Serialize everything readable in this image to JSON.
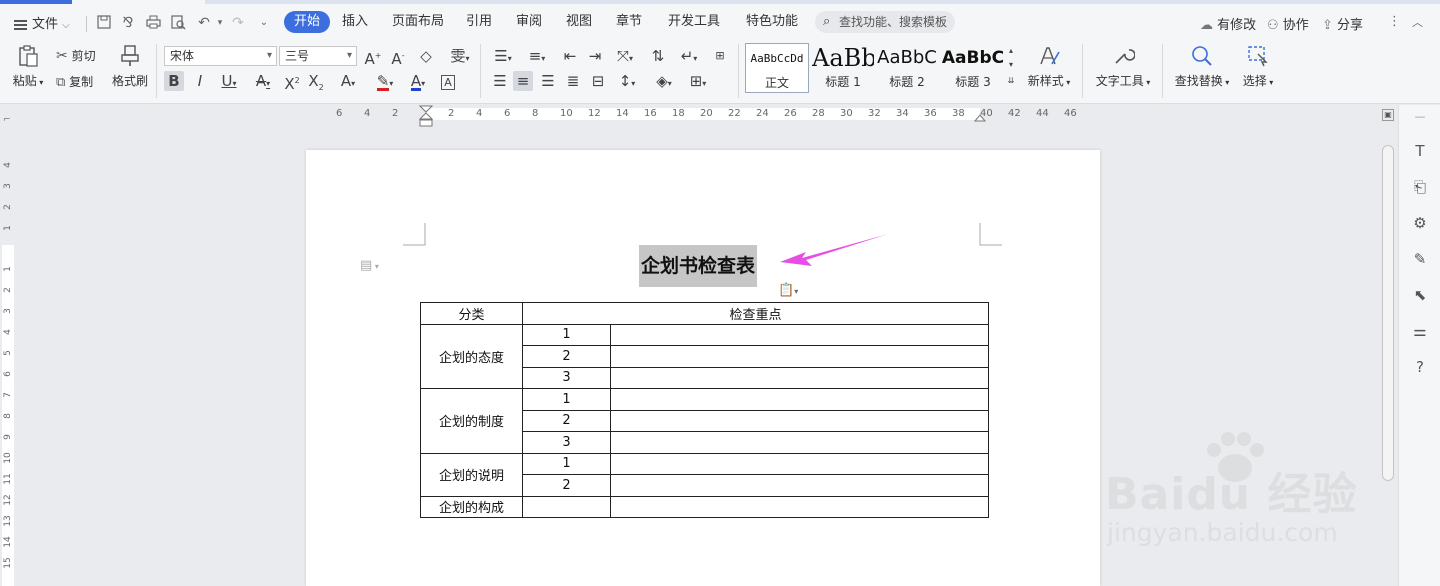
{
  "menubar": {
    "file_label": "文件",
    "tabs": [
      "开始",
      "插入",
      "页面布局",
      "引用",
      "审阅",
      "视图",
      "章节",
      "开发工具",
      "特色功能"
    ],
    "search_placeholder": "查找功能、搜索模板",
    "modified_label": "有修改",
    "collab_label": "协作",
    "share_label": "分享"
  },
  "ribbon": {
    "paste_label": "粘贴",
    "cut_label": "剪切",
    "copy_label": "复制",
    "format_painter_label": "格式刷",
    "font_name": "宋体",
    "font_size": "三号",
    "styles": [
      {
        "preview": "AaBbCcDd",
        "name": "正文"
      },
      {
        "preview": "AaBb",
        "name": "标题 1"
      },
      {
        "preview": "AaBbC",
        "name": "标题 2"
      },
      {
        "preview": "AaBbC",
        "name": "标题 3"
      }
    ],
    "new_style_label": "新样式",
    "text_tools_label": "文字工具",
    "find_replace_label": "查找替换",
    "select_label": "选择"
  },
  "hruler": {
    "ticks": [
      "6",
      "4",
      "2",
      "2",
      "4",
      "6",
      "8",
      "10",
      "12",
      "14",
      "16",
      "18",
      "20",
      "22",
      "24",
      "26",
      "28",
      "30",
      "32",
      "34",
      "36",
      "38",
      "40",
      "42",
      "44",
      "46"
    ]
  },
  "vruler": {
    "ticks": [
      "4",
      "3",
      "2",
      "1",
      "1",
      "2",
      "3",
      "4",
      "5",
      "6",
      "7",
      "8",
      "9",
      "10",
      "11",
      "12",
      "13",
      "14",
      "15"
    ]
  },
  "document": {
    "title": "企划书检查表",
    "header": {
      "col1": "分类",
      "col2": "检查重点"
    },
    "groups": [
      {
        "category": "企划的态度",
        "items": [
          "1",
          "2",
          "3"
        ]
      },
      {
        "category": "企划的制度",
        "items": [
          "1",
          "2",
          "3"
        ]
      },
      {
        "category": "企划的说明",
        "items": [
          "1",
          "2"
        ]
      },
      {
        "category": "企划的构成",
        "items": [
          ""
        ]
      }
    ]
  },
  "watermark": {
    "brand": "Baidu 经验",
    "sub": "jingyan.baidu.com"
  },
  "colors": {
    "accent": "#3c6ede",
    "arrow": "#e64ee6",
    "selection": "#c6c6c6"
  }
}
